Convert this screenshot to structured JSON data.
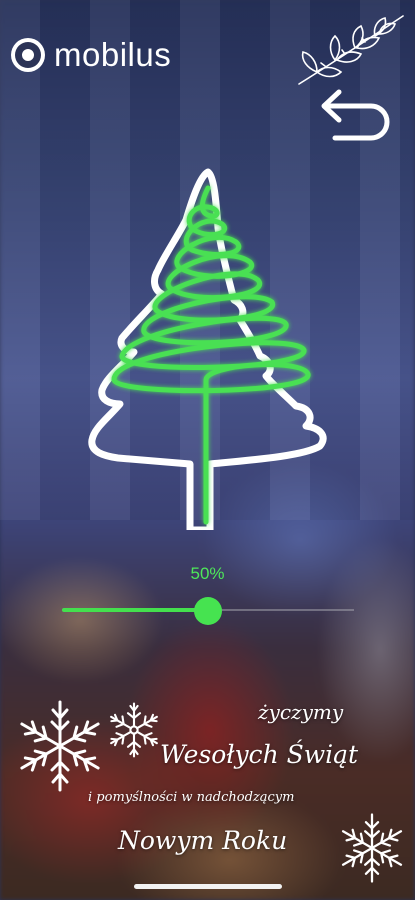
{
  "app": {
    "brand": "mobilus"
  },
  "light": {
    "brightness_percent": 50,
    "brightness_label": "50%"
  },
  "greeting": {
    "line1": "życzymy",
    "line2": "Wesołych Świąt",
    "line3": "i pomyślności w nadchodzącym",
    "line4": "Nowym Roku"
  },
  "colors": {
    "accent_green": "#44e04e",
    "tree_outline": "#ffffff"
  },
  "icons": {
    "back": "back-arrow-icon",
    "logo": "mobilus-logo-icon",
    "tree": "christmas-tree-icon",
    "snowflake": "snowflake-icon"
  }
}
